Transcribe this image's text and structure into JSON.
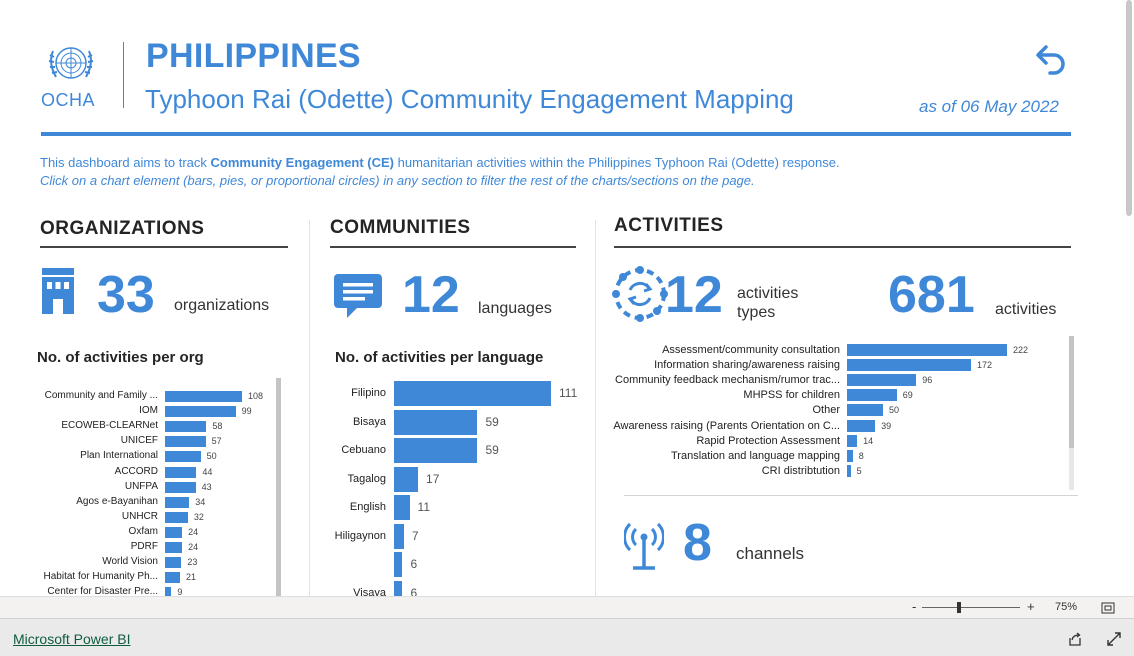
{
  "header": {
    "logo_text": "OCHA",
    "title": "PHILIPPINES",
    "subtitle": "Typhoon Rai (Odette) Community Engagement Mapping",
    "date": "as of 06 May 2022"
  },
  "description": {
    "line1_pre": "This dashboard aims to track ",
    "line1_bold": "Community Engagement (CE)",
    "line1_post": " humanitarian activities within the Philippines Typhoon Rai (Odette) response.",
    "line2": "Click on a chart element (bars, pies, or proportional circles) in any section to filter the rest of the charts/sections on the page."
  },
  "organizations": {
    "title": "ORGANIZATIONS",
    "count": "33",
    "unit": "organizations",
    "chart_title": "No. of activities per org"
  },
  "communities": {
    "title": "COMMUNITIES",
    "count": "12",
    "unit": "languages",
    "chart_title": "No. of activities per language"
  },
  "activities": {
    "title": "ACTIVITIES",
    "types_count": "12",
    "types_unit_line1": "activities",
    "types_unit_line2": "types",
    "total_count": "681",
    "total_unit": "activities"
  },
  "channels": {
    "count": "8",
    "unit": "channels"
  },
  "chart_data": [
    {
      "type": "bar",
      "orientation": "horizontal",
      "title": "No. of activities per org",
      "categories": [
        "Community and Family ...",
        "IOM",
        "ECOWEB-CLEARNet",
        "UNICEF",
        "Plan International",
        "ACCORD",
        "UNFPA",
        "Agos e-Bayanihan",
        "UNHCR",
        "Oxfam",
        "PDRF",
        "World Vision",
        "Habitat for Humanity Ph...",
        "Center for Disaster Pre..."
      ],
      "values": [
        108,
        99,
        58,
        57,
        50,
        44,
        43,
        34,
        32,
        24,
        24,
        23,
        21,
        9
      ]
    },
    {
      "type": "bar",
      "orientation": "horizontal",
      "title": "No. of activities per language",
      "categories": [
        "Filipino",
        "Bisaya",
        "Cebuano",
        "Tagalog",
        "English",
        "Hiligaynon",
        "",
        "Visaya"
      ],
      "values": [
        111,
        59,
        59,
        17,
        11,
        7,
        6,
        6
      ]
    },
    {
      "type": "bar",
      "orientation": "horizontal",
      "title": "",
      "categories": [
        "Assessment/community consultation",
        "Information sharing/awareness raising",
        "Community feedback mechanism/rumor trac...",
        "MHPSS for children",
        "Other",
        "Awareness raising (Parents Orientation on C...",
        "Rapid Protection Assessment",
        "Translation and language mapping",
        "CRI distribtution"
      ],
      "values": [
        222,
        172,
        96,
        69,
        50,
        39,
        14,
        8,
        5
      ]
    }
  ],
  "footer": {
    "zoom_minus": "-",
    "zoom_plus": "+",
    "zoom_level": "75%",
    "powerbi_link": "Microsoft Power BI"
  },
  "colors": {
    "accent": "#3f88d8",
    "header_rule": "#3f88d8"
  }
}
